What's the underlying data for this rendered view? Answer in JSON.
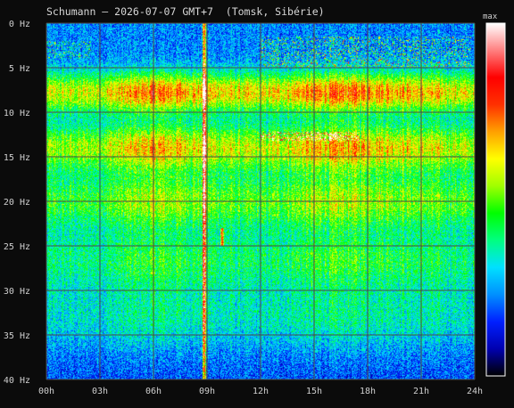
{
  "title": "Schumann — 2026-07-07 GMT+7  (Tomsk, Sibérie)",
  "colorbar_label": "max",
  "chart_data": {
    "type": "heatmap",
    "title": "Schumann — 2026-07-07 GMT+7  (Tomsk, Sibérie)",
    "xlabel": "",
    "ylabel": "",
    "x_ticks": [
      "00h",
      "03h",
      "06h",
      "09h",
      "12h",
      "15h",
      "18h",
      "21h",
      "24h"
    ],
    "x_range_hours": [
      0,
      24
    ],
    "y_ticks": [
      "0 Hz",
      "5 Hz",
      "10 Hz",
      "15 Hz",
      "20 Hz",
      "25 Hz",
      "30 Hz",
      "35 Hz",
      "40 Hz"
    ],
    "y_range_hz": [
      0,
      40
    ],
    "y_inverted": true,
    "grid": true,
    "colorbar": {
      "label": "max",
      "colors": [
        "#000000",
        "#0000b0",
        "#0020ff",
        "#0090ff",
        "#00e0ff",
        "#00ff80",
        "#00ff00",
        "#a0ff00",
        "#ffff00",
        "#ffa000",
        "#ff3000",
        "#ff0000",
        "#ff8080",
        "#ffffff"
      ]
    },
    "resonance_bands_hz": [
      7.8,
      14.0,
      20.0,
      26.5,
      33.0
    ],
    "band_intensity": [
      0.62,
      0.55,
      0.42,
      0.3,
      0.22
    ],
    "interference": [
      {
        "kind": "vertical_line",
        "hour": 8.85,
        "strength": 0.9
      },
      {
        "kind": "vertical_line",
        "hour": 9.85,
        "freq_range_hz": [
          23,
          25
        ],
        "strength": 0.6
      },
      {
        "kind": "low_freq_noise",
        "hours": [
          12,
          23.8
        ],
        "freq_range_hz": [
          1.5,
          5
        ],
        "strength": 0.45
      },
      {
        "kind": "low_freq_noise",
        "hours": [
          0,
          2.5
        ],
        "freq_range_hz": [
          2,
          4
        ],
        "strength": 0.35
      },
      {
        "kind": "tone_cluster",
        "hours": [
          12,
          17.5
        ],
        "freq_hz": 12.7,
        "strength": 0.4
      }
    ],
    "daily_activity": {
      "hours": [
        0,
        3,
        6,
        9,
        12,
        15,
        18,
        21,
        24
      ],
      "level": [
        0.55,
        0.6,
        0.85,
        0.7,
        0.6,
        0.8,
        0.85,
        0.7,
        0.6
      ]
    }
  }
}
